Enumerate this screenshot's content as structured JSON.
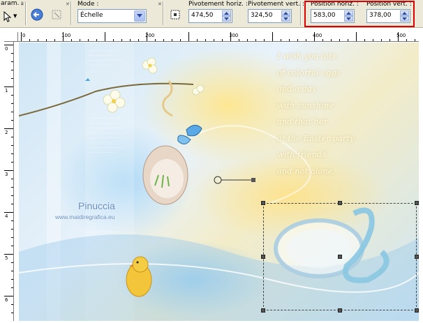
{
  "toolbar": {
    "params_label": "aram. :",
    "mode_label": "Mode :",
    "mode_value": "Échelle",
    "pivot_h_label": "Pivotement horiz. :",
    "pivot_h_value": "474,50",
    "pivot_v_label": "Pivotement vert. :",
    "pivot_v_value": "324,50",
    "pos_h_label": "Position horiz. :",
    "pos_h_value": "583,00",
    "pos_v_label": "Position vert. :",
    "pos_v_value": "378,00"
  },
  "ruler": {
    "top_ticks": [
      "0",
      "100",
      "200",
      "300",
      "400",
      "500"
    ],
    "left_ticks": [
      "0",
      "1",
      "2",
      "3",
      "4",
      "5",
      "6"
    ]
  },
  "canvas": {
    "poem_lines": [
      "I wish you lots",
      "of colorful eggs",
      "and a day",
      "with sunshine",
      "and that her",
      "at the Easter party",
      "with friends",
      "and not alone."
    ],
    "watermark_name": "Pinuccia",
    "watermark_url": "www.maidiregrafica.eu"
  },
  "colors": {
    "highlight": "#e00000",
    "toolbar_bg": "#ece9d8",
    "field_border": "#7f9db9"
  },
  "icons": [
    "pointer-icon",
    "reset-icon",
    "transform-icon",
    "pivot-icon",
    "dropdown-icon"
  ]
}
